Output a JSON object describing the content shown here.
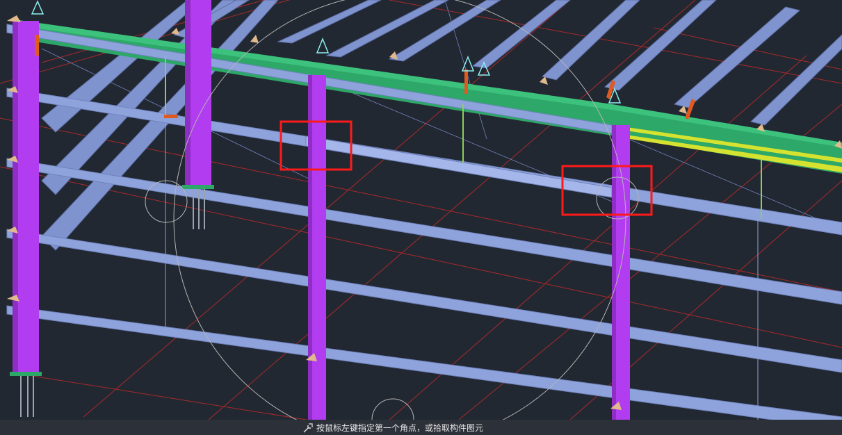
{
  "viewport": {
    "background": "#222831",
    "colors": {
      "column": "#b23cf0",
      "column_shade": "#8e2ec4",
      "purlin": "#8ea2dc",
      "purlin_edge": "#6f82bd",
      "roof_beam": "#2ea868",
      "roof_beam_edge": "#23864f",
      "grid_line": "#c02a2a",
      "highlight": "#e8e82a",
      "selection_box": "#ff1a1a",
      "support": "#e0b98c",
      "marker": "#8af0f0",
      "brace": "#8acf5a",
      "flange_plate": "#e05a20"
    },
    "annotations": [
      "selection-box-left",
      "selection-box-right"
    ]
  },
  "status_bar": {
    "icon": "pick-cursor-icon",
    "prompt": "按鼠标左键指定第一个角点，或拾取构件图元"
  }
}
